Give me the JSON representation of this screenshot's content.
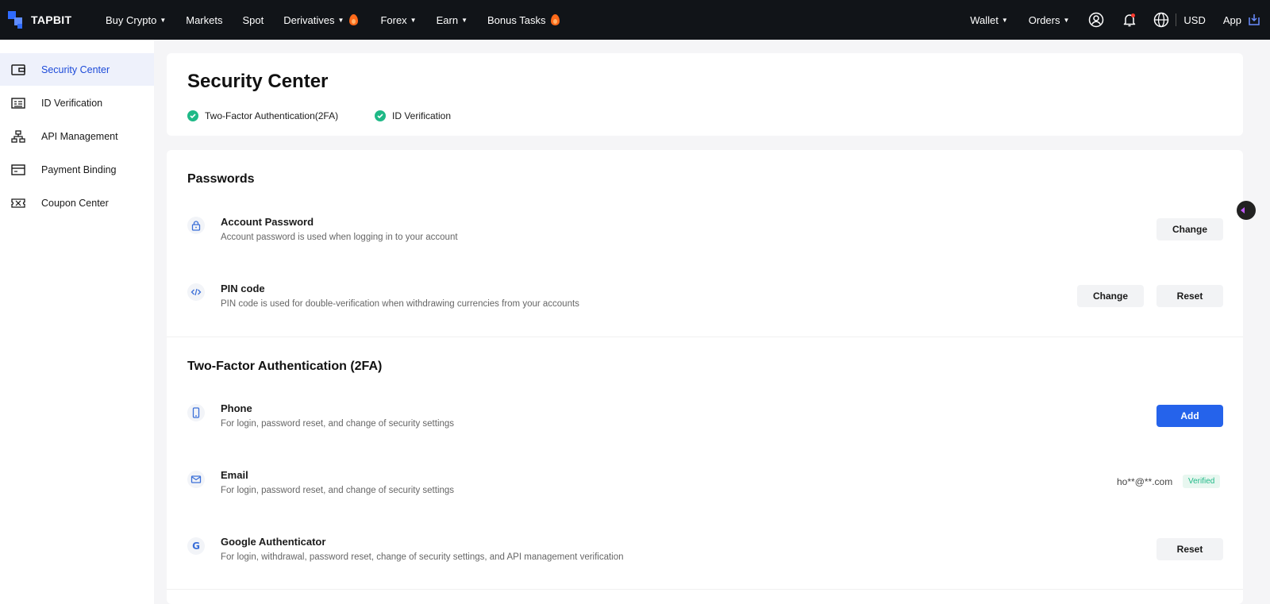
{
  "brand": {
    "name": "TAPBIT"
  },
  "nav": {
    "items": [
      {
        "label": "Buy Crypto",
        "caret": true,
        "hot": false
      },
      {
        "label": "Markets",
        "caret": false,
        "hot": false
      },
      {
        "label": "Spot",
        "caret": false,
        "hot": false
      },
      {
        "label": "Derivatives",
        "caret": true,
        "hot": true
      },
      {
        "label": "Forex",
        "caret": true,
        "hot": false
      },
      {
        "label": "Earn",
        "caret": true,
        "hot": false
      },
      {
        "label": "Bonus Tasks",
        "caret": false,
        "hot": true
      }
    ],
    "right": {
      "wallet": "Wallet",
      "orders": "Orders",
      "currency": "USD",
      "app": "App"
    }
  },
  "sidebar": {
    "items": [
      {
        "label": "Security Center",
        "icon": "wallet-icon",
        "active": true
      },
      {
        "label": "ID Verification",
        "icon": "id-card-icon",
        "active": false
      },
      {
        "label": "API Management",
        "icon": "hierarchy-icon",
        "active": false
      },
      {
        "label": "Payment Binding",
        "icon": "card-icon",
        "active": false
      },
      {
        "label": "Coupon Center",
        "icon": "ticket-icon",
        "active": false
      }
    ]
  },
  "header": {
    "title": "Security Center",
    "statuses": [
      {
        "label": "Two-Factor Authentication(2FA)",
        "done": true
      },
      {
        "label": "ID Verification",
        "done": true
      }
    ]
  },
  "passwords": {
    "title": "Passwords",
    "account_password": {
      "title": "Account Password",
      "desc": "Account password is used when logging in to your account",
      "change_label": "Change"
    },
    "pin_code": {
      "title": "PIN code",
      "desc": "PIN code is used for double-verification when withdrawing currencies from your accounts",
      "change_label": "Change",
      "reset_label": "Reset"
    }
  },
  "twofa": {
    "title": "Two-Factor Authentication (2FA)",
    "phone": {
      "title": "Phone",
      "desc": "For login, password reset, and change of security settings",
      "add_label": "Add"
    },
    "email": {
      "title": "Email",
      "desc": "For login, password reset, and change of security settings",
      "value": "ho**@**.com",
      "badge": "Verified"
    },
    "google": {
      "title": "Google Authenticator",
      "desc": "For login, withdrawal, password reset, change of security settings, and API management verification",
      "reset_label": "Reset"
    }
  },
  "colors": {
    "topbar_bg": "#111418",
    "accent": "#2563eb",
    "success": "#1fb987",
    "sidebar_active_bg": "#eef1fb"
  }
}
